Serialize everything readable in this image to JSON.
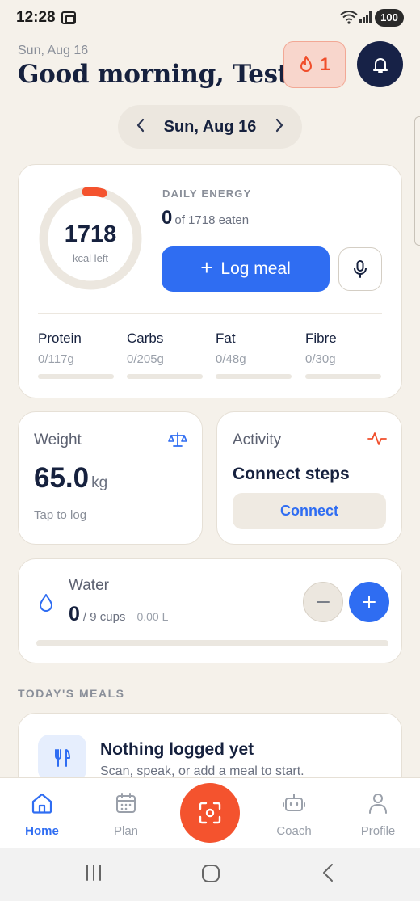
{
  "status_bar": {
    "time": "12:28",
    "battery": "100",
    "wifi_label": "5"
  },
  "header": {
    "date": "Sun, Aug 16",
    "greeting": "Good morning, Test",
    "streak_count": "1"
  },
  "date_nav": {
    "label": "Sun, Aug 16",
    "prev_icon": "chevron-left-icon",
    "next_icon": "chevron-right-icon"
  },
  "energy": {
    "ring_value": "1718",
    "ring_sub": "kcal left",
    "title": "DAILY ENERGY",
    "eaten": "0",
    "eaten_suffix": "of 1718 eaten",
    "log_label": "Log meal",
    "progress_fraction": 0.0,
    "macros": [
      {
        "name": "Protein",
        "value": "0/117g"
      },
      {
        "name": "Carbs",
        "value": "0/205g"
      },
      {
        "name": "Fat",
        "value": "0/48g"
      },
      {
        "name": "Fibre",
        "value": "0/30g"
      }
    ]
  },
  "weight": {
    "title": "Weight",
    "value": "65.0",
    "unit": "kg",
    "hint": "Tap to log"
  },
  "activity": {
    "title": "Activity",
    "heading": "Connect steps",
    "button": "Connect"
  },
  "water": {
    "title": "Water",
    "count": "0",
    "goal": "/ 9 cups",
    "liters": "0.00 L",
    "progress_fraction": 0.0
  },
  "meals": {
    "section_title": "TODAY'S MEALS",
    "empty_title": "Nothing logged yet",
    "empty_sub": "Scan, speak, or add a meal to start."
  },
  "bottom_nav": [
    {
      "label": "Home",
      "icon": "home-icon",
      "active": true
    },
    {
      "label": "Plan",
      "icon": "calendar-icon",
      "active": false
    },
    {
      "label": "Coach",
      "icon": "robot-icon",
      "active": false
    },
    {
      "label": "Profile",
      "icon": "person-icon",
      "active": false
    }
  ],
  "colors": {
    "background": "#f5f1ea",
    "accent_blue": "#2f6df2",
    "accent_orange": "#f4532e",
    "navy": "#172247"
  }
}
